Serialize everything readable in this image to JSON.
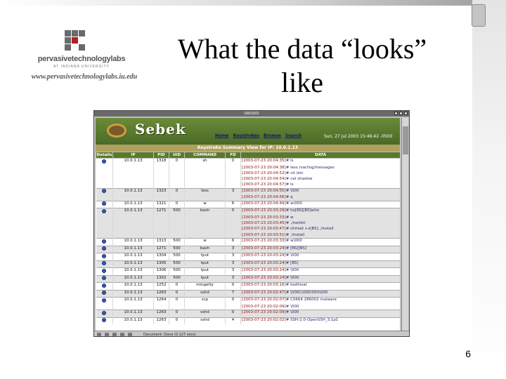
{
  "slide": {
    "title_line1": "What the data “looks”",
    "title_line2": "like",
    "page_number": "6"
  },
  "logo": {
    "name": "pervasivetechnologylabs",
    "subtitle": "AT INDIANA UNIVERSITY",
    "url": "www.pervasivetechnologylabs.iu.edu"
  },
  "browser": {
    "window_title": "SAO3/ID",
    "status_text": "Document: Done (0.127 secs)"
  },
  "sebek": {
    "app_name": "Sebek",
    "nav": [
      "Home",
      "Keystrokes",
      "Browse",
      "Search"
    ],
    "date": "Sun, 27 Jul 2003 15:46:42 -0500",
    "summary_title": "Keystroke Summary View for IP: 10.0.1.13",
    "columns": [
      "Details",
      "IP",
      "PID",
      "UID",
      "COMMAND",
      "FD",
      "DATA"
    ],
    "groups": [
      {
        "ip": "10.0.1.13",
        "pid": "1318",
        "uid": "0",
        "command": "sh",
        "fd": "0",
        "lines": [
          {
            "ts": "[2003-07-23 20:04:35]",
            "cmd": "# ls"
          },
          {
            "ts": "[2003-07-23 20:04:38]",
            "cmd": "# less /var/log/messages"
          },
          {
            "ts": "[2003-07-23 20:04:52]",
            "cmd": "# cd /etc"
          },
          {
            "ts": "[2003-07-23 20:04:54]",
            "cmd": "# cat shadow"
          },
          {
            "ts": "[2003-07-23 20:04:57]",
            "cmd": "# ls"
          }
        ]
      },
      {
        "ip": "10.0.1.13",
        "pid": "1323",
        "uid": "0",
        "command": "less",
        "fd": "3",
        "lines": [
          {
            "ts": "[2003-07-23 20:04:55]",
            "cmd": "# \\000"
          },
          {
            "ts": "[2003-07-23 20:04:56]",
            "cmd": "# q"
          }
        ]
      },
      {
        "ip": "10.0.1.13",
        "pid": "1321",
        "uid": "0",
        "command": "w",
        "fd": "6",
        "lines": [
          {
            "ts": "[2003-07-23 20:04:49]",
            "cmd": "# w\\000"
          }
        ]
      },
      {
        "ip": "10.0.1.13",
        "pid": "1271",
        "uid": "500",
        "command": "bash",
        "fd": "0",
        "lines": [
          {
            "ts": "[2003-07-23 20:03:29]",
            "cmd": "# ho[BS][BS]who"
          },
          {
            "ts": "[2003-07-23 20:03:33]",
            "cmd": "# w"
          },
          {
            "ts": "[2003-07-23 20:03:45]",
            "cmd": "# ./rootkit"
          },
          {
            "ts": "[2003-07-23 20:03:47]",
            "cmd": "# chmod +x[BS] ./install"
          },
          {
            "ts": "[2003-07-23 20:03:51]",
            "cmd": "# ./install"
          }
        ]
      },
      {
        "ip": "10.0.1.13",
        "pid": "1313",
        "uid": "500",
        "command": "w",
        "fd": "6",
        "lines": [
          {
            "ts": "[2003-07-23 20:03:33]",
            "cmd": "# w\\000"
          }
        ]
      },
      {
        "ip": "10.0.1.13",
        "pid": "1271",
        "uid": "500",
        "command": "bash",
        "fd": "3",
        "lines": [
          {
            "ts": "[2003-07-23 20:03:24]",
            "cmd": "# [BS][BS]"
          }
        ]
      },
      {
        "ip": "10.0.1.13",
        "pid": "1304",
        "uid": "500",
        "command": "tput",
        "fd": "3",
        "lines": [
          {
            "ts": "[2003-07-23 20:03:24]",
            "cmd": "# \\000"
          }
        ]
      },
      {
        "ip": "10.0.1.13",
        "pid": "1305",
        "uid": "500",
        "command": "tput",
        "fd": "3",
        "lines": [
          {
            "ts": "[2003-07-23 20:03:24]",
            "cmd": "# [BS]"
          }
        ]
      },
      {
        "ip": "10.0.1.13",
        "pid": "1306",
        "uid": "500",
        "command": "tput",
        "fd": "3",
        "lines": [
          {
            "ts": "[2003-07-23 20:03:24]",
            "cmd": "# \\000"
          }
        ]
      },
      {
        "ip": "10.0.1.13",
        "pid": "1302",
        "uid": "500",
        "command": "tput",
        "fd": "3",
        "lines": [
          {
            "ts": "[2003-07-23 20:03:24]",
            "cmd": "# \\000"
          }
        ]
      },
      {
        "ip": "10.0.1.13",
        "pid": "1252",
        "uid": "0",
        "command": "mingetty",
        "fd": "0",
        "lines": [
          {
            "ts": "[2003-07-23 20:03:16]",
            "cmd": "# bodhisat"
          }
        ]
      },
      {
        "ip": "10.0.1.13",
        "pid": "1263",
        "uid": "0",
        "command": "sshd",
        "fd": "7",
        "lines": [
          {
            "ts": "[2003-07-23 20:02:47]",
            "cmd": "# \\000C\\000\\000\\000"
          }
        ]
      },
      {
        "ip": "10.0.1.13",
        "pid": "1264",
        "uid": "0",
        "command": "scp",
        "fd": "0",
        "lines": [
          {
            "ts": "[2003-07-23 20:02:07]",
            "cmd": "# C0664 286002 malware"
          },
          {
            "ts": "[2003-07-23 20:02:09]",
            "cmd": "# \\000"
          }
        ]
      },
      {
        "ip": "10.0.1.13",
        "pid": "1263",
        "uid": "0",
        "command": "sshd",
        "fd": "0",
        "lines": [
          {
            "ts": "[2003-07-23 20:02:09]",
            "cmd": "# \\000"
          }
        ]
      },
      {
        "ip": "10.0.1.13",
        "pid": "1263",
        "uid": "0",
        "command": "sshd",
        "fd": "4",
        "lines": [
          {
            "ts": "[2003-07-23 20:02:02]",
            "cmd": "# SSH-2.0-OpenSSH_3.1p1"
          }
        ]
      }
    ]
  },
  "colors": {
    "header_green": "#5a7a2a",
    "summary_bar": "#b0a060",
    "timestamp_red": "#8a1010"
  }
}
